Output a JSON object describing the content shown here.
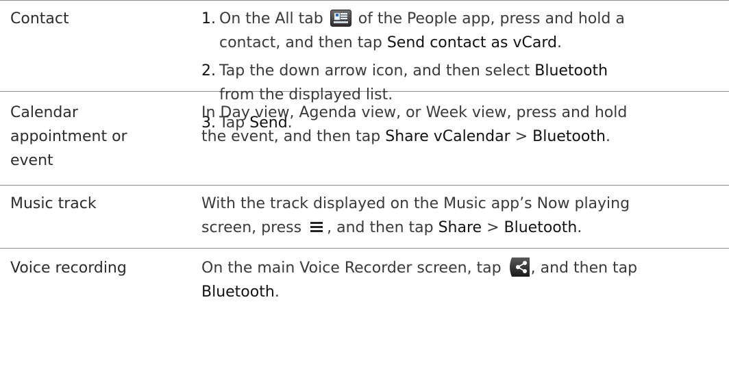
{
  "rows": [
    {
      "label": "Contact",
      "steps": [
        {
          "num": "1.",
          "line1_a": "On the All tab",
          "line1_b": "of the People app, press and hold a",
          "line2_a": "contact, and then tap",
          "line2_bold": "Send contact as vCard",
          "line2_end": "."
        },
        {
          "num": "2.",
          "line1_a": "Tap the down arrow icon, and then select",
          "line1_bold": "Bluetooth",
          "line2_a": "from the displayed list."
        },
        {
          "num": "3.",
          "line1_a": "Tap",
          "line1_bold": "Send",
          "line1_end": "."
        }
      ]
    },
    {
      "label_lines": [
        "Calendar",
        "appointment or",
        "event"
      ],
      "line1": "In Day view, Agenda view, or Week view, press and hold",
      "line2_a": "the event, and then tap",
      "line2_bold1": "Share vCalendar",
      "line2_sep": ">",
      "line2_bold2": "Bluetooth",
      "line2_end": "."
    },
    {
      "label": "Music track",
      "line1": "With the track displayed on the Music app’s Now playing",
      "line2_a": "screen, press",
      "line2_b": ", and then tap",
      "line2_bold1": "Share",
      "line2_sep": ">",
      "line2_bold2": "Bluetooth",
      "line2_end": "."
    },
    {
      "label": "Voice recording",
      "line1_a": "On the main Voice Recorder screen, tap",
      "line1_b": ", and then tap",
      "line2_bold": "Bluetooth",
      "line2_end": "."
    }
  ],
  "icons": {
    "people_tab": "people-all-tab-icon",
    "menu": "menu-icon",
    "voice_share": "voice-share-icon"
  },
  "colors": {
    "rule": "#8f8f8f",
    "text": "#2c2c2c",
    "bold_text": "#111111"
  }
}
